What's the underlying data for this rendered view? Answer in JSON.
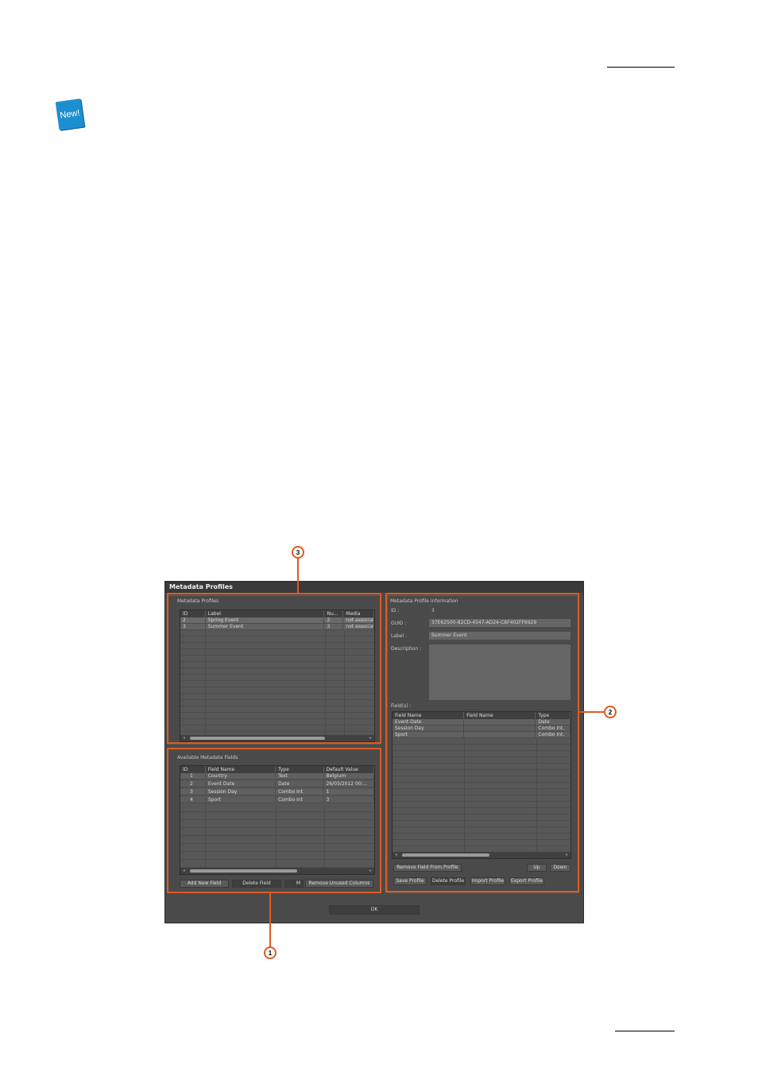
{
  "badge": {
    "text": "New!"
  },
  "colors": {
    "callout": "#e05a1e",
    "badge": "#1d8fd0",
    "dialog_bg": "#4a4a4a"
  },
  "dialog": {
    "title": "Metadata Profiles",
    "profiles_panel": {
      "label": "Metadata Profiles",
      "columns": [
        "ID",
        "Label",
        "Nu...",
        "Media"
      ],
      "rows": [
        [
          "2",
          "Spring Event",
          "2",
          "not associat"
        ],
        [
          "3",
          "Summer Event",
          "3",
          "not associat"
        ]
      ]
    },
    "fields_panel": {
      "label": "Available Metadata Fields",
      "columns": [
        "ID",
        "Field Name",
        "Type",
        "Default Value"
      ],
      "rows": [
        [
          "1",
          "Country",
          "Text",
          "Belgium"
        ],
        [
          "2",
          "Event Date",
          "Date",
          "26/03/2012 00:..."
        ],
        [
          "3",
          "Session Day",
          "Combo Int",
          "1"
        ],
        [
          "4",
          "Sport",
          "Combo Int",
          "3"
        ]
      ],
      "buttons": [
        "Add New Field",
        "Delete Field",
        "M",
        "Remove Unused Columns"
      ]
    },
    "info_panel": {
      "label": "Metadata Profile Information",
      "id_label": "ID :",
      "id_value": "3",
      "guid_label": "GUID :",
      "guid_value": "37E62500-82CD-4547-AD24-C8F402FF6929",
      "label_label": "Label :",
      "label_value": "Summer Event",
      "description_label": "Description :",
      "fields_label": "Field(s) :",
      "columns": [
        "Field Name",
        "Field Name",
        "Type"
      ],
      "rows": [
        [
          "Event Date",
          "",
          "Date"
        ],
        [
          "Session Day",
          "",
          "Combo Int."
        ],
        [
          "Sport",
          "",
          "Combo Int."
        ]
      ],
      "buttons_row1": [
        "Remove Field From Profile",
        "Up",
        "Down"
      ],
      "buttons_row2": [
        "Save Profile",
        "Delete Profile",
        "Import Profile",
        "Export Profile"
      ]
    },
    "ok_label": "OK"
  },
  "callouts": [
    "1",
    "2",
    "3"
  ]
}
